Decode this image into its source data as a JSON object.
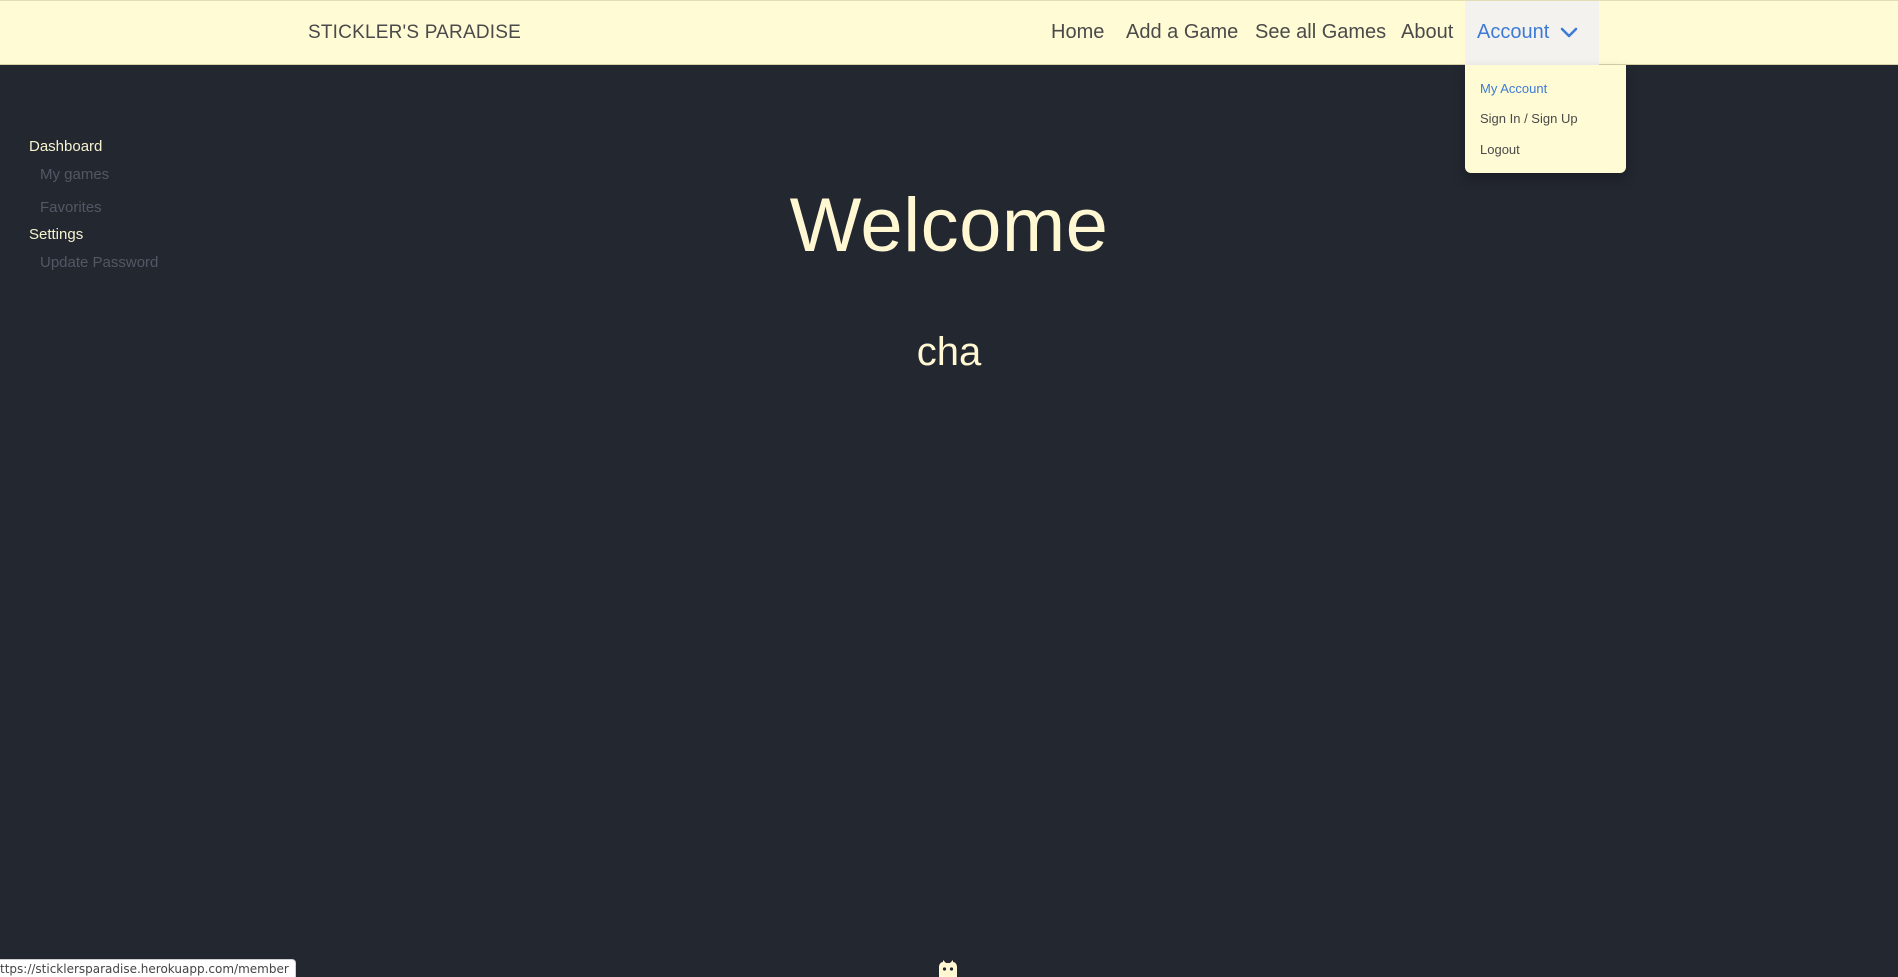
{
  "header": {
    "brand": "STICKLER'S PARADISE",
    "nav": {
      "home": "Home",
      "add_game": "Add a Game",
      "see_all": "See all Games",
      "about": "About",
      "account": "Account"
    }
  },
  "account_menu": {
    "items": [
      "My Account",
      "Sign In / Sign Up",
      "Logout"
    ]
  },
  "sidebar": {
    "dashboard": {
      "label": "Dashboard",
      "links": [
        "My games",
        "Favorites"
      ]
    },
    "settings": {
      "label": "Settings",
      "links": [
        "Update Password"
      ]
    }
  },
  "main": {
    "welcome": "Welcome",
    "username": "cha"
  },
  "status_bar": {
    "url": "ttps://sticklersparadise.herokuapp.com/member"
  },
  "icons": {
    "account_dropdown": "chevron-down-icon",
    "footer": "github-icon"
  },
  "colors": {
    "background": "#232730",
    "navbar": "#fffbd5",
    "accent": "#3e7bd6",
    "text_light": "#fff8d2"
  }
}
